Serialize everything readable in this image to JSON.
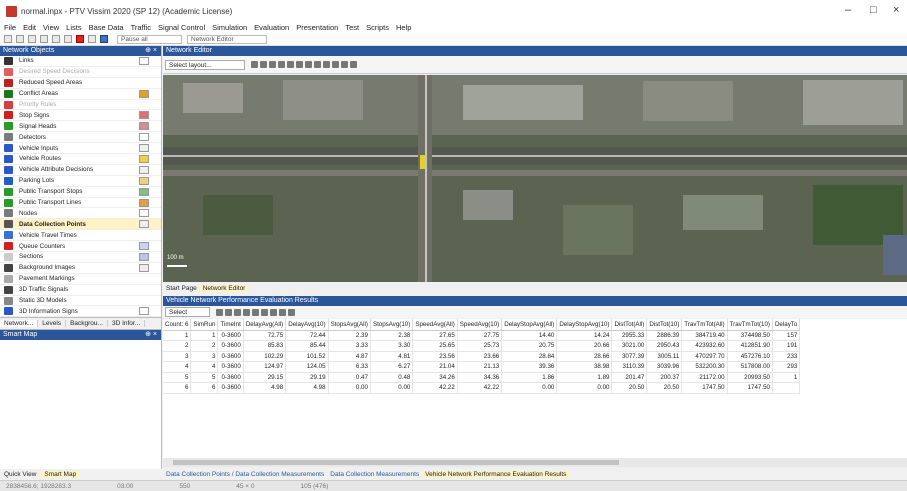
{
  "window": {
    "title": "normal.inpx - PTV Vissim 2020 (SP 12) (Academic License)",
    "minimize": "–",
    "maximize": "□",
    "close": "×"
  },
  "menu": [
    "File",
    "Edit",
    "View",
    "Lists",
    "Base Data",
    "Traffic",
    "Signal Control",
    "Simulation",
    "Evaluation",
    "Presentation",
    "Test",
    "Scripts",
    "Help"
  ],
  "toolbar": {
    "pause": "Pause all",
    "editor": "Network Editor"
  },
  "network_objects": {
    "header": "Network Objects",
    "pin": "⊕ ×",
    "items": [
      {
        "label": "Links",
        "style": "normal",
        "icon_color": "#333333",
        "swatch": "#ffffff"
      },
      {
        "label": "Desired Speed Decisions",
        "style": "dim",
        "icon_color": "#e06060",
        "swatch": ""
      },
      {
        "label": "Reduced Speed Areas",
        "style": "normal",
        "icon_color": "#c02020",
        "swatch": ""
      },
      {
        "label": "Conflict Areas",
        "style": "normal",
        "icon_color": "#1b7a1b",
        "swatch": "#e0a020"
      },
      {
        "label": "Priority Rules",
        "style": "dim",
        "icon_color": "#d04040",
        "swatch": ""
      },
      {
        "label": "Stop Signs",
        "style": "normal",
        "icon_color": "#d02020",
        "swatch": "#e07070"
      },
      {
        "label": "Signal Heads",
        "style": "normal",
        "icon_color": "#2a9a2a",
        "swatch": "#d09090"
      },
      {
        "label": "Detectors",
        "style": "normal",
        "icon_color": "#7a7a7a",
        "swatch": "#ffffff"
      },
      {
        "label": "Vehicle Inputs",
        "style": "normal",
        "icon_color": "#2b57c8",
        "swatch": "#eeeeee"
      },
      {
        "label": "Vehicle Routes",
        "style": "normal",
        "icon_color": "#2b57c8",
        "swatch": "#f0d040"
      },
      {
        "label": "Vehicle Attribute Decisions",
        "style": "normal",
        "icon_color": "#2b57c8",
        "swatch": "#eeeeee"
      },
      {
        "label": "Parking Lots",
        "style": "normal",
        "icon_color": "#1e5fc8",
        "swatch": "#f0d080"
      },
      {
        "label": "Public Transport Stops",
        "style": "normal",
        "icon_color": "#2a9a2a",
        "swatch": "#80c080"
      },
      {
        "label": "Public Transport Lines",
        "style": "normal",
        "icon_color": "#2a9a2a",
        "swatch": "#e0a040"
      },
      {
        "label": "Nodes",
        "style": "normal",
        "icon_color": "#7a7a7a",
        "swatch": "#ffffff"
      },
      {
        "label": "Data Collection Points",
        "style": "bold",
        "icon_color": "#555555",
        "swatch": "#eeeeee"
      },
      {
        "label": "Vehicle Travel Times",
        "style": "normal",
        "icon_color": "#3a6fd8",
        "swatch": ""
      },
      {
        "label": "Queue Counters",
        "style": "normal",
        "icon_color": "#d02020",
        "swatch": "#d0d0f0"
      },
      {
        "label": "Sections",
        "style": "normal",
        "icon_color": "#cccccc",
        "swatch": "#c0c0f0"
      },
      {
        "label": "Background Images",
        "style": "normal",
        "icon_color": "#444444",
        "swatch": "#eeeeee"
      },
      {
        "label": "Pavement Markings",
        "style": "normal",
        "icon_color": "#aaaaaa",
        "swatch": ""
      },
      {
        "label": "3D Traffic Signals",
        "style": "normal",
        "icon_color": "#444444",
        "swatch": ""
      },
      {
        "label": "Static 3D Models",
        "style": "normal",
        "icon_color": "#888888",
        "swatch": ""
      },
      {
        "label": "3D Information Signs",
        "style": "normal",
        "icon_color": "#2b57c8",
        "swatch": "#ffffff"
      }
    ]
  },
  "left_tabs": [
    "Network...",
    "Levels",
    "Backgrou...",
    "3D Infor..."
  ],
  "smart_map": {
    "header": "Smart Map",
    "pin": "⊕ ×"
  },
  "left_bottom_tabs": [
    "Quick View",
    "Smart Map"
  ],
  "network_editor": {
    "header": "Network Editor",
    "layout_placeholder": "Select layout..."
  },
  "page_tabs": [
    "Start Page",
    "Network Editor"
  ],
  "results": {
    "header": "Vehicle Network Performance Evaluation Results",
    "layout_placeholder": "Select layout...",
    "columns": [
      "Count: 6",
      "SimRun",
      "TimeInt",
      "DelayAvg(All)",
      "DelayAvg(10)",
      "StopsAvg(All)",
      "StopsAvg(10)",
      "SpeedAvg(All)",
      "SpeedAvg(10)",
      "DelayStopAvg(All)",
      "DelayStopAvg(10)",
      "DistTot(All)",
      "DistTot(10)",
      "TravTmTot(All)",
      "TravTmTot(10)",
      "DelayTo"
    ],
    "rows": [
      [
        "1",
        "1",
        "0-3600",
        "72.75",
        "72.44",
        "2.39",
        "2.38",
        "27.65",
        "27.75",
        "14.40",
        "14.24",
        "2955.33",
        "2886.39",
        "384719.40",
        "374498.50",
        "157"
      ],
      [
        "2",
        "2",
        "0-3600",
        "85.83",
        "85.44",
        "3.33",
        "3.30",
        "25.65",
        "25.73",
        "20.75",
        "20.66",
        "3021.00",
        "2950.43",
        "423932.60",
        "412851.90",
        "191"
      ],
      [
        "3",
        "3",
        "0-3600",
        "102.29",
        "101.52",
        "4.87",
        "4.81",
        "23.56",
        "23.66",
        "28.84",
        "28.66",
        "3077.39",
        "3005.11",
        "470297.70",
        "457276.10",
        "233"
      ],
      [
        "4",
        "4",
        "0-3600",
        "124.97",
        "124.05",
        "6.33",
        "6.27",
        "21.04",
        "21.13",
        "39.36",
        "38.98",
        "3110.39",
        "3039.96",
        "532200.30",
        "517808.00",
        "293"
      ],
      [
        "5",
        "5",
        "0-3600",
        "29.15",
        "29.19",
        "0.47",
        "0.48",
        "34.26",
        "34.36",
        "1.86",
        "1.89",
        "201.47",
        "200.37",
        "21172.00",
        "20993.50",
        "1"
      ],
      [
        "6",
        "6",
        "0-3600",
        "4.98",
        "4.98",
        "0.00",
        "0.00",
        "42.22",
        "42.22",
        "0.00",
        "0.00",
        "20.50",
        "20.50",
        "1747.50",
        "1747.50",
        ""
      ]
    ]
  },
  "bottom_tabs": [
    "Data Collection Points / Data Collection Measurements",
    "Data Collection Measurements",
    "Vehicle Network Performance Evaluation Results"
  ],
  "status": [
    "2838456.6; 1928283.3",
    "03:00",
    "550",
    "45 × 0",
    "105 (476)"
  ],
  "map_scale": "100 m"
}
